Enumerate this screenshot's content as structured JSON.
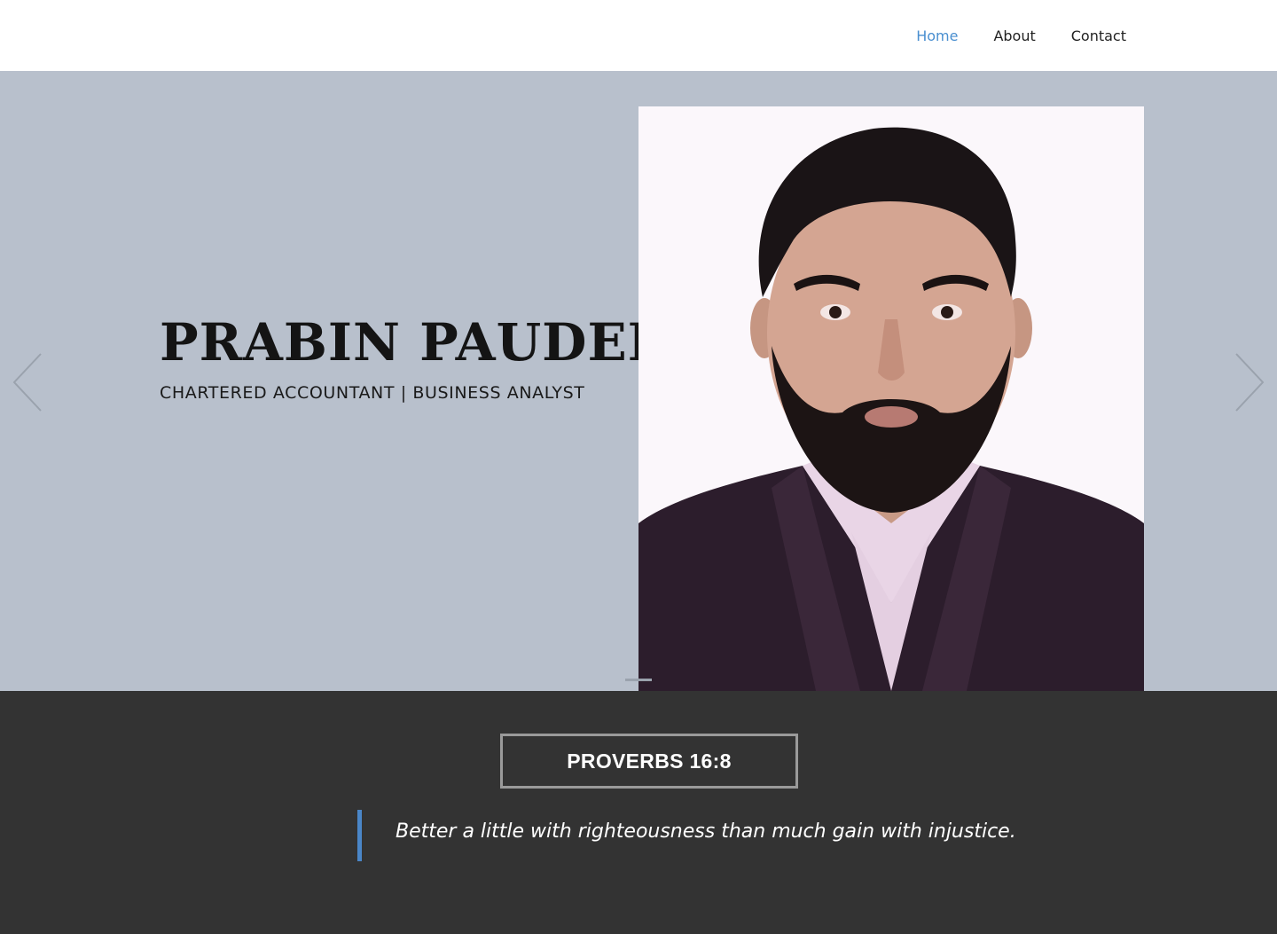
{
  "nav": {
    "items": [
      {
        "label": "Home",
        "active": true
      },
      {
        "label": "About",
        "active": false
      },
      {
        "label": "Contact",
        "active": false
      }
    ],
    "active_color": "#4a8fd0"
  },
  "hero": {
    "name": "PRABIN PAUDEL",
    "subtitle": "CHARTERED ACCOUNTANT | BUSINESS ANALYST",
    "background_color": "#b8c0cc",
    "prev_icon": "chevron-left-icon",
    "next_icon": "chevron-right-icon",
    "slides_count": 1,
    "active_slide": 1
  },
  "quote": {
    "reference": "PROVERBS 16:8",
    "text": "Better a little with righteousness than much gain with injustice.",
    "background_color": "#333333",
    "accent_color": "#4a86c8"
  }
}
